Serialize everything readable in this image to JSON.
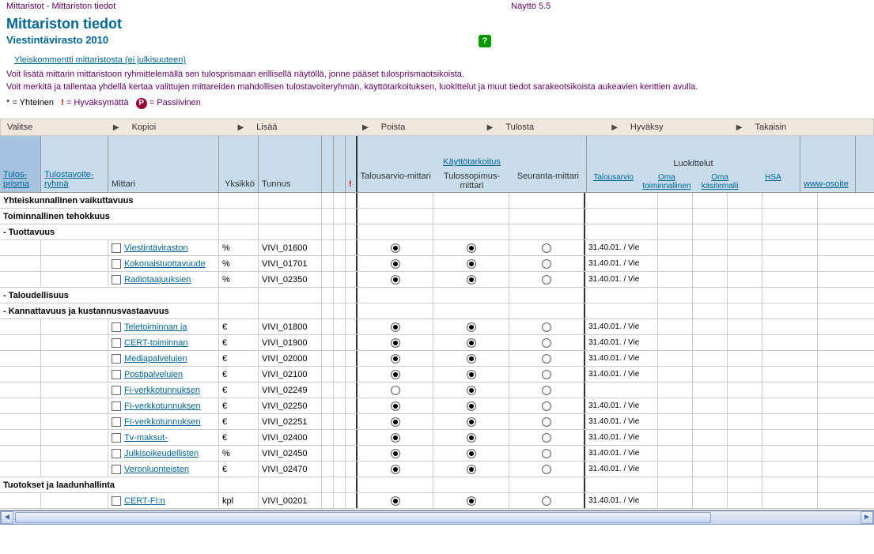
{
  "breadcrumb": "Mittaristot - Mittariston tiedot",
  "screen": "Näyttö 5.5",
  "title": "Mittariston tiedot",
  "subtitle": "Viestintävirasto  2010",
  "comment_link": "Yleiskommentti mittaristosta (ei julkisuuteen)",
  "desc1": "Voit lisätä mittarin mittaristoon ryhmittelemällä sen tulosprismaan erillisellä näytöllä, jonne pääset tulosprismaotsikoista.",
  "desc2": "Voit merkitä ja tallentaa yhdellä kertaa valittujen mittareiden mahdollisen tulostavoiteryhmän, käyttötarkoituksen, luokittelut ja muut tiedot sarakeotsikoista aukeavien kenttien avulla.",
  "legend": {
    "star": "* = Yhteinen",
    "ex": "= Hyväksymättä",
    "p": "= Passiivinen"
  },
  "menu": [
    "Valitse",
    "Kopioi",
    "Lisää",
    "Poista",
    "Tulosta",
    "Hyväksy",
    "Takaisin"
  ],
  "headers": {
    "tulos": "Tulos-prisma",
    "ryhma": "Tulostavoite-ryhmä",
    "mittari": "Mittari",
    "yksikko": "Yksikkö",
    "tunnus": "Tunnus",
    "kaytto": "Käyttötarkoitus",
    "k1": "Talousarvio-mittari",
    "k2": "Tulossopimus-mittari",
    "k3": "Seuranta-mittari",
    "luokittelut": "Luokittelut",
    "l1": "Talousarvio",
    "l2": "Oma toiminnallinen",
    "l3": "Oma käsitemalli",
    "l4": "HSA",
    "www": "www-osoite"
  },
  "groups": [
    {
      "label": "Yhteiskunnallinen vaikuttavuus",
      "rows": []
    },
    {
      "label": "Toiminnallinen tehokkuus",
      "rows": []
    },
    {
      "label": "- Tuottavuus",
      "rows": [
        {
          "name": "Viestintäviraston",
          "unit": "%",
          "id": "VIVI_01600",
          "k1": true,
          "k2": true,
          "k3": false,
          "ta": "31.40.01. / Vie"
        },
        {
          "name": "Kokonaistuottavuude",
          "unit": "%",
          "id": "VIVI_01701",
          "k1": true,
          "k2": true,
          "k3": false,
          "ta": "31.40.01. / Vie"
        },
        {
          "name": "Radiotaajuuksien",
          "unit": "%",
          "id": "VIVI_02350",
          "k1": true,
          "k2": true,
          "k3": false,
          "ta": "31.40.01. / Vie"
        }
      ]
    },
    {
      "label": "- Taloudellisuus",
      "rows": []
    },
    {
      "label": "- Kannattavuus ja kustannusvastaavuus",
      "rows": [
        {
          "name": "Teletoiminnan ja",
          "unit": "€",
          "id": "VIVI_01800",
          "k1": true,
          "k2": true,
          "k3": false,
          "ta": "31.40.01. / Vie"
        },
        {
          "name": "CERT-toiminnan",
          "unit": "€",
          "id": "VIVI_01900",
          "k1": true,
          "k2": true,
          "k3": false,
          "ta": "31.40.01. / Vie"
        },
        {
          "name": "Mediapalvelujen",
          "unit": "€",
          "id": "VIVI_02000",
          "k1": true,
          "k2": true,
          "k3": false,
          "ta": "31.40.01. / Vie"
        },
        {
          "name": "Postipalvelujen",
          "unit": "€",
          "id": "VIVI_02100",
          "k1": true,
          "k2": true,
          "k3": false,
          "ta": "31.40.01. / Vie"
        },
        {
          "name": "Fi-verkkotunnuksen",
          "unit": "€",
          "id": "VIVI_02249",
          "k1": false,
          "k2": true,
          "k3": false,
          "ta": ""
        },
        {
          "name": "FI-verkkotunnuksen",
          "unit": "€",
          "id": "VIVI_02250",
          "k1": true,
          "k2": true,
          "k3": false,
          "ta": "31.40.01. / Vie"
        },
        {
          "name": "FI-verkkotunnuksen",
          "unit": "€",
          "id": "VIVI_02251",
          "k1": true,
          "k2": true,
          "k3": false,
          "ta": "31.40.01. / Vie"
        },
        {
          "name": "Tv-maksut-",
          "unit": "€",
          "id": "VIVI_02400",
          "k1": true,
          "k2": true,
          "k3": false,
          "ta": "31.40.01. / Vie"
        },
        {
          "name": "Julkisoikeudellisten",
          "unit": "%",
          "id": "VIVI_02450",
          "k1": true,
          "k2": true,
          "k3": false,
          "ta": "31.40.01. / Vie"
        },
        {
          "name": "Veronluonteisten",
          "unit": "€",
          "id": "VIVI_02470",
          "k1": true,
          "k2": true,
          "k3": false,
          "ta": "31.40.01. / Vie"
        }
      ]
    },
    {
      "label": "Tuotokset ja laadunhallinta",
      "rows": [
        {
          "name": "CERT-FI:n",
          "unit": "kpl",
          "id": "VIVI_00201",
          "k1": true,
          "k2": true,
          "k3": false,
          "ta": "31.40.01. / Vie"
        }
      ]
    }
  ]
}
